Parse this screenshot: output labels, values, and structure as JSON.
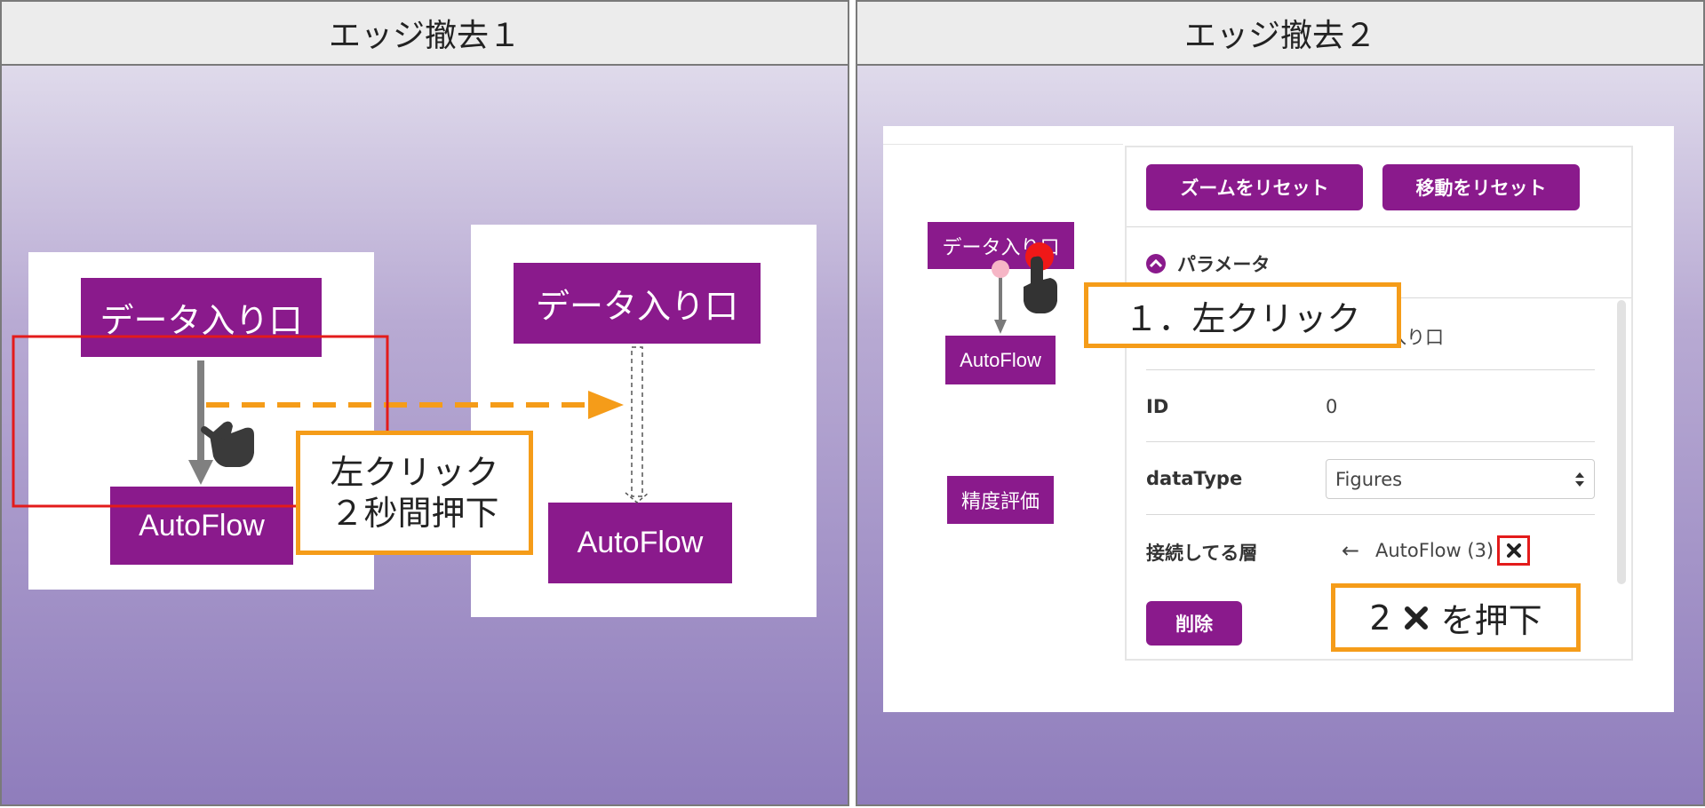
{
  "colors": {
    "node_purple": "#8a1a8c",
    "callout_orange": "#f59c19",
    "highlight_red": "#e31b1b"
  },
  "left_panel": {
    "title": "エッジ撤去１",
    "before": {
      "source_node": "データ入り口",
      "target_node": "AutoFlow"
    },
    "after": {
      "source_node": "データ入り口",
      "target_node": "AutoFlow"
    },
    "callout": {
      "line1": "左クリック",
      "line2": "２秒間押下"
    },
    "icons": [
      "hand-pointer-icon"
    ]
  },
  "right_panel": {
    "title": "エッジ撤去２",
    "graph": {
      "source_node": "データ入り口",
      "target_node": "AutoFlow",
      "eval_node": "精度評価"
    },
    "toolbar": {
      "reset_zoom": "ズームをリセット",
      "reset_move": "移動をリセット"
    },
    "params": {
      "header": "パラメータ",
      "name_partial": "入り口",
      "id_label": "ID",
      "id_value": "0",
      "datatype_label": "dataType",
      "datatype_value": "Figures",
      "connected_label": "接続してる層",
      "connected_arrow": "←",
      "connected_value": "AutoFlow (3)",
      "delete_button": "削除"
    },
    "callout1": "１．左クリック",
    "callout2_num": "2",
    "callout2_text": "を押下",
    "icons": [
      "hand-pointer-icon",
      "chevron-up-circle-icon",
      "close-icon",
      "select-arrows-icon"
    ]
  }
}
